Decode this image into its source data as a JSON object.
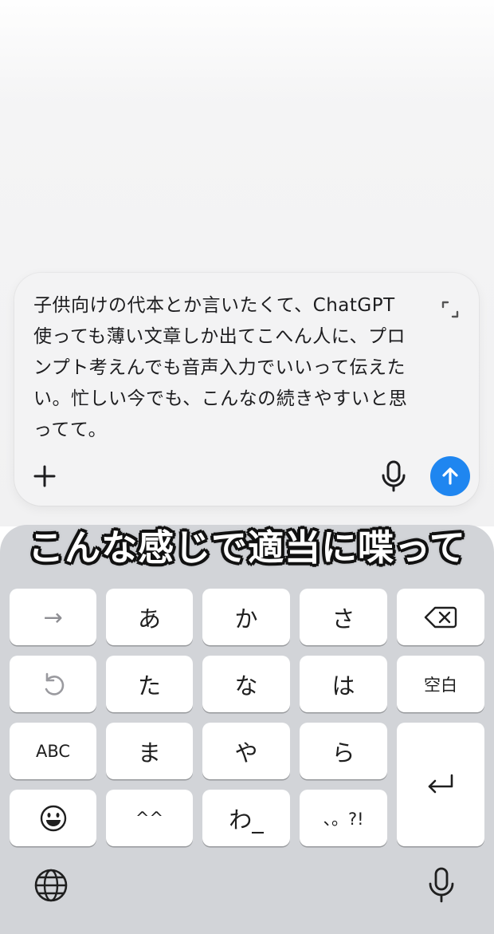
{
  "composer": {
    "text": "子供向けの代本とか言いたくて、ChatGPT使っても薄い文章しか出てこへん人に、プロンプト考えんでも音声入力でいいって伝えたい。忙しい今でも、こんなの続きやすいと思ってて。",
    "icons": {
      "expand": "expand-icon",
      "add": "plus-icon",
      "dictate": "microphone-icon",
      "send": "arrow-up-icon"
    },
    "colors": {
      "send": "#1f86f0"
    }
  },
  "caption": {
    "text": "こんな感じで適当に喋って"
  },
  "keyboard": {
    "keys": {
      "next": "→",
      "a": "あ",
      "ka": "か",
      "sa": "さ",
      "undo": "undo-icon",
      "ta": "た",
      "na": "な",
      "ha": "は",
      "space": "空白",
      "abc": "ABC",
      "ma": "ま",
      "ya": "や",
      "ra": "ら",
      "emoji": "emoji-icon",
      "kaomoji": "^^",
      "wa": "わ_",
      "punct": "、。?!",
      "delete": "delete-icon",
      "return": "return-icon"
    },
    "bottom": {
      "globe": "globe-icon",
      "mic": "microphone-icon"
    }
  }
}
